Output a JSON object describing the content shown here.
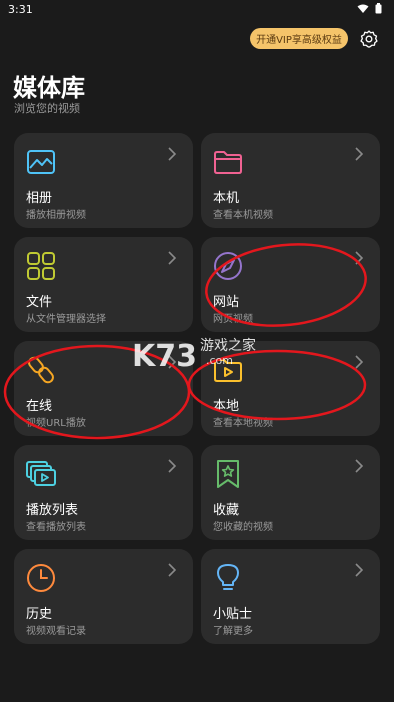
{
  "status": {
    "time": "3:31"
  },
  "vip_button": "开通VIP享高级权益",
  "header": {
    "title": "媒体库",
    "subtitle": "浏览您的视频"
  },
  "cards": [
    {
      "title": "相册",
      "subtitle": "播放相册视频",
      "icon": "gallery-icon",
      "color": "#4fc3f7"
    },
    {
      "title": "本机",
      "subtitle": "查看本机视频",
      "icon": "folder-icon",
      "color": "#f06292"
    },
    {
      "title": "文件",
      "subtitle": "从文件管理器选择",
      "icon": "apps-grid-icon",
      "color": "#c0ca33"
    },
    {
      "title": "网站",
      "subtitle": "网页视频",
      "icon": "compass-icon",
      "color": "#9575cd"
    },
    {
      "title": "在线",
      "subtitle": "视频URL播放",
      "icon": "link-icon",
      "color": "#f5a623"
    },
    {
      "title": "本地",
      "subtitle": "查看本地视频",
      "icon": "video-folder-icon",
      "color": "#fbc02d"
    },
    {
      "title": "播放列表",
      "subtitle": "查看播放列表",
      "icon": "playlist-icon",
      "color": "#4dd0e1"
    },
    {
      "title": "收藏",
      "subtitle": "您收藏的视频",
      "icon": "bookmark-star-icon",
      "color": "#66bb6a"
    },
    {
      "title": "历史",
      "subtitle": "视频观看记录",
      "icon": "clock-icon",
      "color": "#ff8a3d"
    },
    {
      "title": "小贴士",
      "subtitle": "了解更多",
      "icon": "lightbulb-icon",
      "color": "#64b5f6"
    }
  ],
  "watermark": {
    "brand": "K73",
    "text": "游戏之家",
    "domain": ".com"
  }
}
